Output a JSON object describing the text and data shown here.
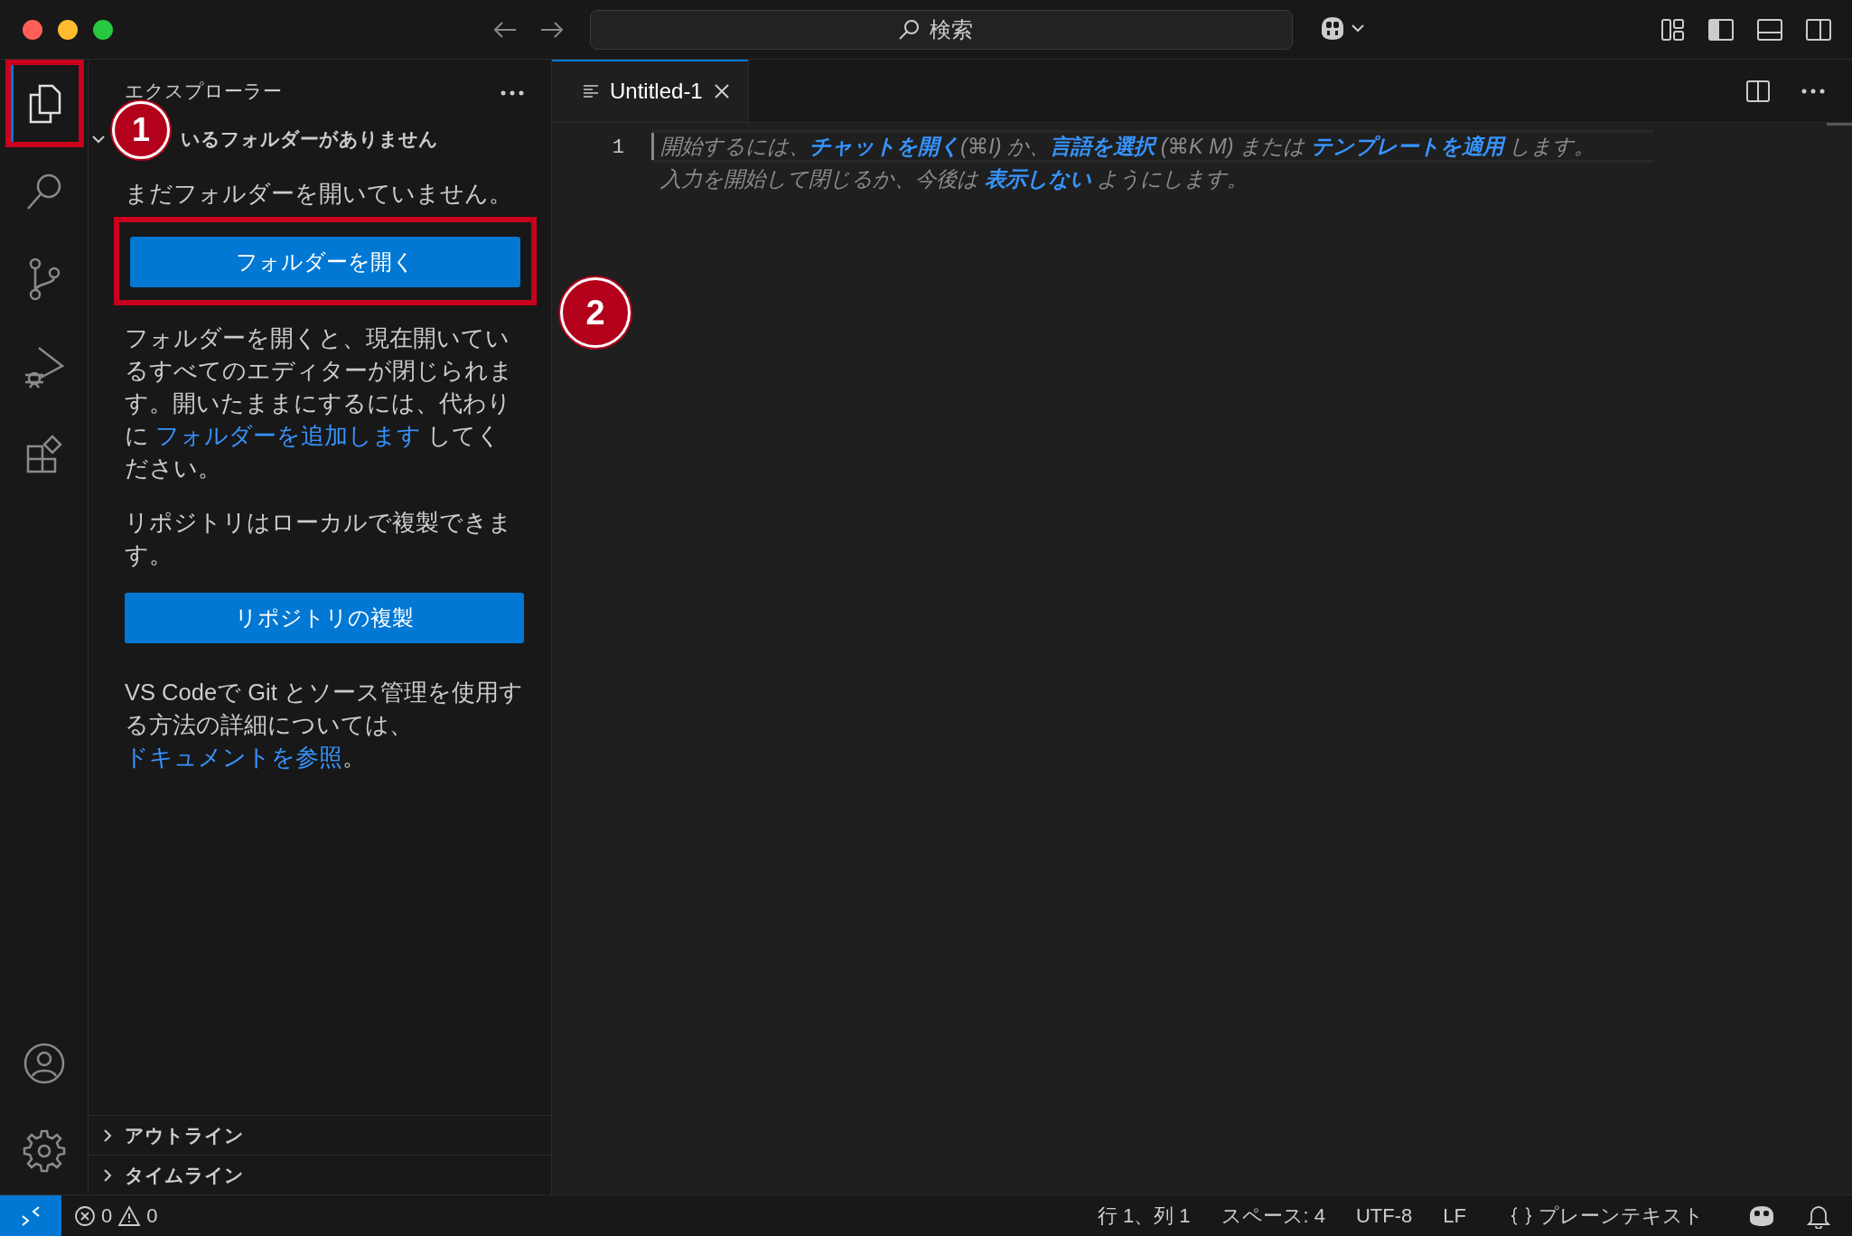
{
  "title_bar": {
    "search_placeholder": "検索"
  },
  "activity_bar": [
    {
      "kind": "explorer",
      "selected": true,
      "highlighted": true
    },
    {
      "kind": "search",
      "selected": false,
      "highlighted": false
    },
    {
      "kind": "source-control",
      "selected": false,
      "highlighted": false
    },
    {
      "kind": "run",
      "selected": false,
      "highlighted": false
    },
    {
      "kind": "extensions",
      "selected": false,
      "highlighted": false
    }
  ],
  "activity_bar_bottom": [
    {
      "kind": "account"
    },
    {
      "kind": "settings"
    }
  ],
  "sidebar": {
    "title": "エクスプローラー",
    "section": {
      "label": "いるフォルダーがありません",
      "expanded": true
    },
    "intro": "まだフォルダーを開いていません。",
    "open_button": {
      "label": "フォルダーを開く",
      "highlighted": true
    },
    "paragraph_1": [
      {
        "text": "フォルダーを開くと、現在開いているすべてのエディターが閉じられます。開いたままにするには、代わりに ",
        "link": false
      },
      {
        "text": "フォルダーを追加します",
        "link": true
      },
      {
        "text": " してください。",
        "link": false
      }
    ],
    "paragraph_2": "リポジトリはローカルで複製できます。",
    "clone_button": {
      "label": "リポジトリの複製"
    },
    "paragraph_3": [
      {
        "text": "VS Codeで Git とソース管理を使用する方法の詳細については、",
        "link": false
      },
      {
        "text": "ドキュメントを参照",
        "link": true
      },
      {
        "text": "。",
        "link": false
      }
    ],
    "collapsed_sections": [
      {
        "label": "アウトライン",
        "expanded": false
      },
      {
        "label": "タイムライン",
        "expanded": false
      }
    ]
  },
  "annotations": [
    {
      "label": "1"
    },
    {
      "label": "2"
    }
  ],
  "tabs": [
    {
      "label": "Untitled-1",
      "selected": true
    }
  ],
  "editor": {
    "line_number": "1",
    "hint_lines": [
      [
        {
          "text": "開始するには、",
          "link": false
        },
        {
          "text": "チャットを開く",
          "link": true
        },
        {
          "text": "(⌘I) か、",
          "link": false
        },
        {
          "text": "言語を選択",
          "link": true
        },
        {
          "text": " (⌘K M) または ",
          "link": false
        },
        {
          "text": "テンプレートを適用",
          "link": true
        },
        {
          "text": " します。",
          "link": false
        }
      ],
      [
        {
          "text": "入力を開始して閉じるか、今後は ",
          "link": false
        },
        {
          "text": "表示しない",
          "link": true
        },
        {
          "text": " ようにします。",
          "link": false
        }
      ]
    ]
  },
  "status_bar": {
    "errors": "0",
    "warnings": "0",
    "items": [
      "行 1、列 1",
      "スペース: 4",
      "UTF-8",
      "LF"
    ],
    "language": "プレーンテキスト"
  }
}
